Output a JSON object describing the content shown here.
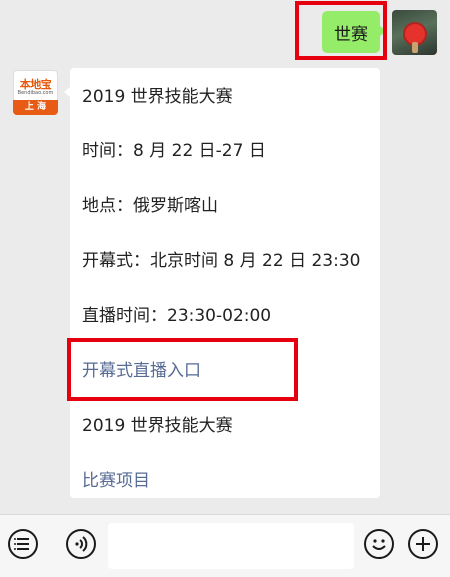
{
  "outgoing": {
    "text": "世赛"
  },
  "card": {
    "lines": [
      "2019 世界技能大赛",
      "时间：8 月 22 日-27 日",
      "地点：俄罗斯喀山",
      "开幕式：北京时间 8 月 22 日 23:30",
      "直播时间：23:30-02:00",
      "开幕式直播入口",
      "2019 世界技能大赛",
      "比赛项目"
    ]
  },
  "bot_avatar": {
    "brand": "本地宝",
    "site": "Bendibao.com",
    "city": "上 海"
  },
  "input": {
    "value": ""
  },
  "colors": {
    "bubble_green": "#95ec69",
    "link": "#576b95",
    "highlight": "#e6000f"
  },
  "icons": [
    "avatar-photo",
    "menu-icon",
    "voice-icon",
    "emoji-icon",
    "plus-icon"
  ]
}
